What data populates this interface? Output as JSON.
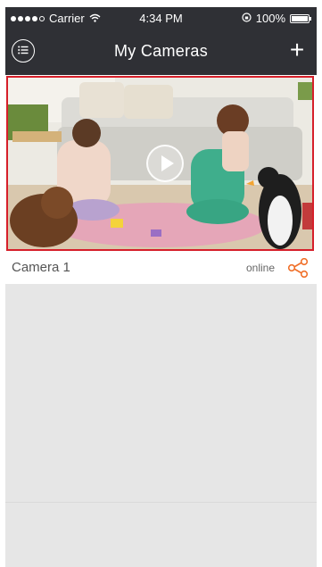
{
  "status_bar": {
    "carrier": "Carrier",
    "time": "4:34 PM",
    "battery": "100%",
    "battery_level": 1.0
  },
  "header": {
    "title": "My Cameras",
    "add_label": "+"
  },
  "cameras": [
    {
      "name": "Camera 1",
      "status": "online"
    }
  ],
  "colors": {
    "nav_bg": "#2f3035",
    "selected_border": "#d61f2a",
    "share_icon": "#f0702a",
    "list_bg": "#e6e6e6"
  },
  "icons": {
    "menu": "list-icon",
    "add": "plus-icon",
    "play": "play-icon",
    "share": "share-icon"
  }
}
